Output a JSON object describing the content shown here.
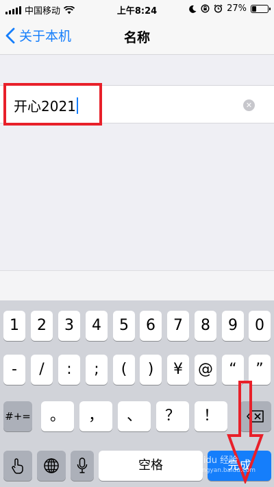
{
  "status_bar": {
    "carrier": "中国移动",
    "time": "上午8:24",
    "battery_percent": "27%",
    "battery_level": 0.27,
    "icons": [
      "signal-icon",
      "wifi-icon",
      "moon-icon",
      "rotation-lock-icon",
      "alarm-icon",
      "battery-icon"
    ]
  },
  "nav": {
    "back_label": "关于本机",
    "title": "名称"
  },
  "name_field": {
    "value": "开心2021",
    "clear_icon": "clear-icon"
  },
  "keyboard": {
    "row1": [
      "1",
      "2",
      "3",
      "4",
      "5",
      "6",
      "7",
      "8",
      "9",
      "0"
    ],
    "row2": [
      "-",
      "/",
      ":",
      ";",
      "(",
      ")",
      "¥",
      "@",
      "“",
      "”"
    ],
    "row3_left": "#+=",
    "row3": [
      "。",
      "，",
      "、",
      "？",
      "！",
      "."
    ],
    "space": "空格",
    "return": "完成",
    "icons": [
      "handwriting-icon",
      "globe-icon",
      "microphone-icon",
      "backspace-icon"
    ]
  },
  "watermark": {
    "brand": "Baidu 经验",
    "url": "jingyan.baidu.com"
  },
  "colors": {
    "accent": "#157efb",
    "annotation": "#e8202a"
  }
}
